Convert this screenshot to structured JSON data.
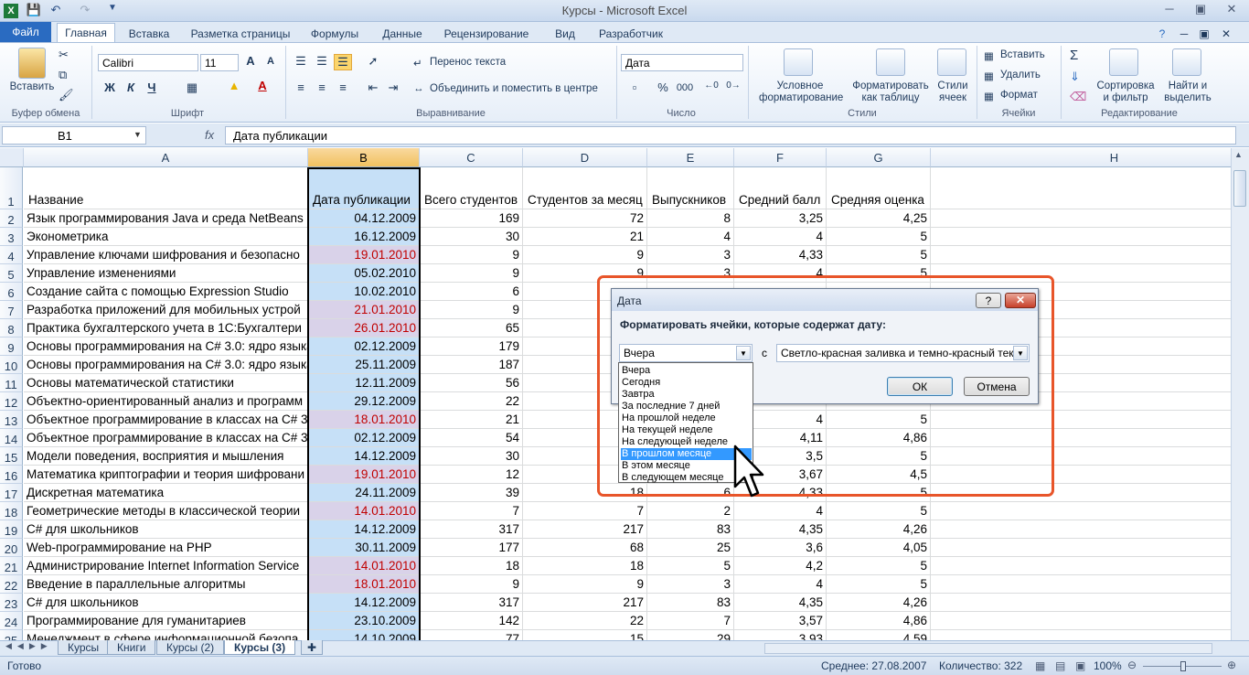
{
  "window": {
    "title": "Курсы  -  Microsoft Excel"
  },
  "tabs": [
    "Файл",
    "Главная",
    "Вставка",
    "Разметка страницы",
    "Формулы",
    "Данные",
    "Рецензирование",
    "Вид",
    "Разработчик"
  ],
  "ribbon": {
    "clipboard": {
      "paste": "Вставить",
      "group": "Буфер обмена"
    },
    "font": {
      "name": "Calibri",
      "size": "11",
      "group": "Шрифт",
      "bold": "Ж",
      "italic": "К",
      "underline": "Ч"
    },
    "alignment": {
      "wrap": "Перенос текста",
      "merge": "Объединить и поместить в центре",
      "group": "Выравнивание"
    },
    "number": {
      "format": "Дата",
      "group": "Число",
      "percent": "%",
      "thousands": "000"
    },
    "styles": {
      "conditional": "Условное форматирование",
      "table": "Форматировать как таблицу",
      "cell": "Стили ячеек",
      "group": "Стили"
    },
    "cells": {
      "insert": "Вставить",
      "delete": "Удалить",
      "format": "Формат",
      "group": "Ячейки"
    },
    "editing": {
      "sort": "Сортировка и фильтр",
      "find": "Найти и выделить",
      "group": "Редактирование"
    }
  },
  "formula_bar": {
    "name_box": "B1",
    "fx": "fx",
    "content": "Дата публикации"
  },
  "columns": [
    "A",
    "B",
    "C",
    "D",
    "E",
    "F",
    "G",
    "H"
  ],
  "headers": {
    "a": "Название",
    "b": "Дата публикации",
    "c": "Всего студентов",
    "d": "Студентов за месяц",
    "e": "Выпускников",
    "f": "Средний балл",
    "g": "Средняя оценка"
  },
  "rows": [
    {
      "n": "2",
      "a": "Язык программирования Java и среда NetBeans",
      "b": "04.12.2009",
      "c": "169",
      "d": "72",
      "e": "8",
      "f": "3,25",
      "g": "4,25",
      "hl": "blue"
    },
    {
      "n": "3",
      "a": "Эконометрика",
      "b": "16.12.2009",
      "c": "30",
      "d": "21",
      "e": "4",
      "f": "4",
      "g": "5",
      "hl": "blue"
    },
    {
      "n": "4",
      "a": "Управление ключами шифрования и безопасно",
      "b": "19.01.2010",
      "c": "9",
      "d": "9",
      "e": "3",
      "f": "4,33",
      "g": "5",
      "hl": "red"
    },
    {
      "n": "5",
      "a": "Управление изменениями",
      "b": "05.02.2010",
      "c": "9",
      "d": "9",
      "e": "3",
      "f": "4",
      "g": "5",
      "hl": "blue"
    },
    {
      "n": "6",
      "a": "Создание сайта с помощью Expression Studio",
      "b": "10.02.2010",
      "c": "6",
      "d": "",
      "e": "",
      "f": "",
      "g": "",
      "hl": "blue"
    },
    {
      "n": "7",
      "a": "Разработка приложений для мобильных устрой",
      "b": "21.01.2010",
      "c": "9",
      "d": "",
      "e": "",
      "f": "",
      "g": "",
      "hl": "red"
    },
    {
      "n": "8",
      "a": "Практика бухгалтерского учета в 1С:Бухгалтери",
      "b": "26.01.2010",
      "c": "65",
      "d": "",
      "e": "",
      "f": "",
      "g": "",
      "hl": "red"
    },
    {
      "n": "9",
      "a": "Основы программирования на C# 3.0: ядро языка",
      "b": "02.12.2009",
      "c": "179",
      "d": "",
      "e": "",
      "f": "",
      "g": "",
      "hl": "blue"
    },
    {
      "n": "10",
      "a": "Основы программирования на C# 3.0: ядро языка",
      "b": "25.11.2009",
      "c": "187",
      "d": "",
      "e": "",
      "f": "",
      "g": "",
      "hl": "blue"
    },
    {
      "n": "11",
      "a": "Основы математической статистики",
      "b": "12.11.2009",
      "c": "56",
      "d": "",
      "e": "",
      "f": "",
      "g": "",
      "hl": "blue"
    },
    {
      "n": "12",
      "a": "Объектно-ориентированный анализ и программ",
      "b": "29.12.2009",
      "c": "22",
      "d": "",
      "e": "",
      "f": "",
      "g": "",
      "hl": "blue"
    },
    {
      "n": "13",
      "a": "Объектное программирование в классах на C# 3",
      "b": "18.01.2010",
      "c": "21",
      "d": "",
      "e": "",
      "f": "4",
      "g": "5",
      "hl": "red"
    },
    {
      "n": "14",
      "a": "Объектное программирование в классах на C# 3",
      "b": "02.12.2009",
      "c": "54",
      "d": "",
      "e": "",
      "f": "4,11",
      "g": "4,86",
      "hl": "blue"
    },
    {
      "n": "15",
      "a": "Модели поведения, восприятия и мышления",
      "b": "14.12.2009",
      "c": "30",
      "d": "",
      "e": "",
      "f": "3,5",
      "g": "5",
      "hl": "blue"
    },
    {
      "n": "16",
      "a": "Математика криптографии и теория шифровани",
      "b": "19.01.2010",
      "c": "12",
      "d": "",
      "e": "",
      "f": "3,67",
      "g": "4,5",
      "hl": "red"
    },
    {
      "n": "17",
      "a": "Дискретная математика",
      "b": "24.11.2009",
      "c": "39",
      "d": "18",
      "e": "6",
      "f": "4,33",
      "g": "5",
      "hl": "blue"
    },
    {
      "n": "18",
      "a": "Геометрические методы в классической теории",
      "b": "14.01.2010",
      "c": "7",
      "d": "7",
      "e": "2",
      "f": "4",
      "g": "5",
      "hl": "red"
    },
    {
      "n": "19",
      "a": "C# для школьников",
      "b": "14.12.2009",
      "c": "317",
      "d": "217",
      "e": "83",
      "f": "4,35",
      "g": "4,26",
      "hl": "blue"
    },
    {
      "n": "20",
      "a": "Web-программирование на PHP",
      "b": "30.11.2009",
      "c": "177",
      "d": "68",
      "e": "25",
      "f": "3,6",
      "g": "4,05",
      "hl": "blue"
    },
    {
      "n": "21",
      "a": "Администрирование Internet Information Service",
      "b": "14.01.2010",
      "c": "18",
      "d": "18",
      "e": "5",
      "f": "4,2",
      "g": "5",
      "hl": "red"
    },
    {
      "n": "22",
      "a": "Введение в параллельные алгоритмы",
      "b": "18.01.2010",
      "c": "9",
      "d": "9",
      "e": "3",
      "f": "4",
      "g": "5",
      "hl": "red"
    },
    {
      "n": "23",
      "a": "C# для школьников",
      "b": "14.12.2009",
      "c": "317",
      "d": "217",
      "e": "83",
      "f": "4,35",
      "g": "4,26",
      "hl": "blue"
    },
    {
      "n": "24",
      "a": "Программирование для гуманитариев",
      "b": "23.10.2009",
      "c": "142",
      "d": "22",
      "e": "7",
      "f": "3,57",
      "g": "4,86",
      "hl": "blue"
    },
    {
      "n": "25",
      "a": "Менеджмент в сфере информационной безопа",
      "b": "14.10.2009",
      "c": "77",
      "d": "15",
      "e": "29",
      "f": "3,93",
      "g": "4,59",
      "hl": "blue"
    }
  ],
  "sheets": [
    "Курсы",
    "Книги",
    "Курсы (2)",
    "Курсы (3)"
  ],
  "status": {
    "ready": "Готово",
    "average": "Среднее: 27.08.2007",
    "count": "Количество: 322",
    "zoom": "100%"
  },
  "dialog": {
    "title": "Дата",
    "prompt": "Форматировать ячейки, которые содержат дату:",
    "selected": "Вчера",
    "with": "с",
    "format": "Светло-красная заливка и темно-красный текст",
    "ok": "ОК",
    "cancel": "Отмена",
    "help": "?",
    "options": [
      "Вчера",
      "Сегодня",
      "Завтра",
      "За последние 7 дней",
      "На прошлой неделе",
      "На текущей неделе",
      "На следующей неделе",
      "В прошлом месяце",
      "В этом месяце",
      "В следующем месяце"
    ],
    "highlighted_option": "В прошлом месяце"
  }
}
